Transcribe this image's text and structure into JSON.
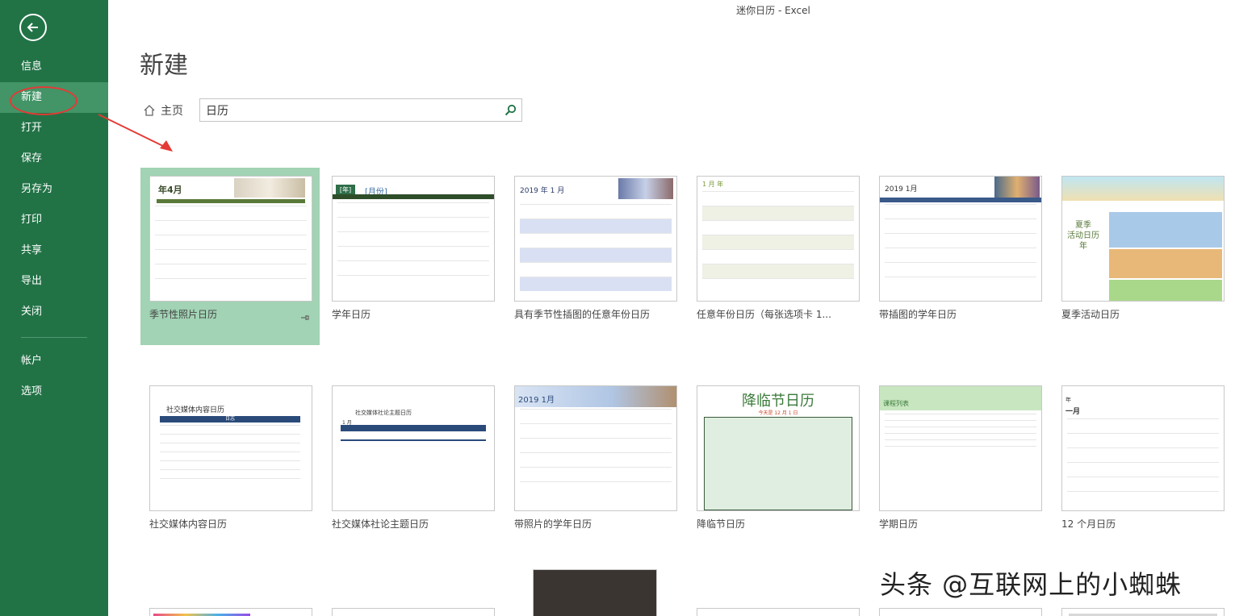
{
  "window": {
    "title": "迷你日历 - Excel"
  },
  "sidebar": {
    "items": [
      {
        "label": "信息"
      },
      {
        "label": "新建"
      },
      {
        "label": "打开"
      },
      {
        "label": "保存"
      },
      {
        "label": "另存为"
      },
      {
        "label": "打印"
      },
      {
        "label": "共享"
      },
      {
        "label": "导出"
      },
      {
        "label": "关闭"
      },
      {
        "label": "帐户"
      },
      {
        "label": "选项"
      }
    ],
    "active_index": 1,
    "bg_color": "#217346",
    "active_color": "#439467"
  },
  "main": {
    "page_title": "新建",
    "home_label": "主页",
    "search": {
      "value": "日历",
      "icon": "search-icon"
    }
  },
  "thumbs": {
    "t1": {
      "title": "年4月"
    },
    "t2": {
      "tag": "[年]",
      "month": "[月份]"
    },
    "t3": {
      "title": "2019 年 1 月"
    },
    "t4": {
      "title": "1 月  年"
    },
    "t5": {
      "title": "2019 1月"
    },
    "t6": {
      "title": "夏季\n活动日历\n年"
    },
    "t7": {
      "title": "社交媒体内容日历",
      "sub": "日志"
    },
    "t8": {
      "title": "社交媒体社论主题日历",
      "month": "1 月"
    },
    "t9": {
      "title": "2019 1月"
    },
    "t10": {
      "title": "降临节日历",
      "sub": "今天是 12 月 1 日"
    },
    "t11": {
      "title": "课程列表"
    },
    "t12": {
      "year": "年",
      "month": "一月"
    }
  },
  "templates": [
    {
      "label": "季节性照片日历"
    },
    {
      "label": "学年日历"
    },
    {
      "label": "具有季节性插图的任意年份日历"
    },
    {
      "label": "任意年份日历（每张选项卡 1..."
    },
    {
      "label": "带插图的学年日历"
    },
    {
      "label": "夏季活动日历"
    },
    {
      "label": "社交媒体内容日历"
    },
    {
      "label": "社交媒体社论主题日历"
    },
    {
      "label": "带照片的学年日历"
    },
    {
      "label": "降临节日历"
    },
    {
      "label": "学期日历"
    },
    {
      "label": "12 个月日历"
    }
  ],
  "watermark": {
    "text": "头条 @互联网上的小蜘蛛"
  },
  "colors": {
    "accent": "#217346",
    "selected_card": "#a1d3b4",
    "annotation": "#e53935"
  }
}
